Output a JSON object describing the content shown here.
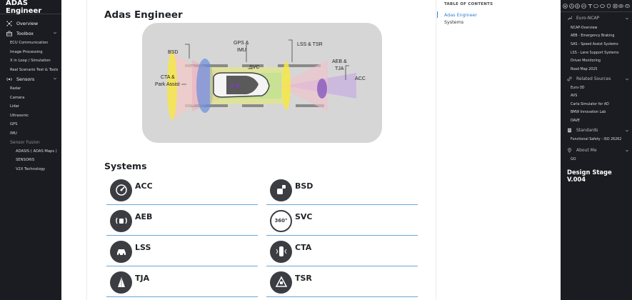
{
  "left_sidebar": {
    "brand": "ADAS Engineer",
    "items": [
      {
        "label": "Overview"
      },
      {
        "label": "Toolbox"
      },
      {
        "label": "ECU Communication"
      },
      {
        "label": "Image Processing"
      },
      {
        "label": "X in Loop / Simulation"
      },
      {
        "label": "Real Scenario Test & Tools"
      },
      {
        "label": "Sensors"
      },
      {
        "label": "Radar"
      },
      {
        "label": "Camera"
      },
      {
        "label": "Lidar"
      },
      {
        "label": "Ultrasonic"
      },
      {
        "label": "GPS"
      },
      {
        "label": "IMU"
      },
      {
        "label": "Sensor Fusion"
      },
      {
        "label": "ADASIS ( ADAS Maps )"
      },
      {
        "label": "SENSORIS"
      },
      {
        "label": "V2X Technology"
      }
    ]
  },
  "main": {
    "title": "Adas Engineer",
    "diagram": {
      "labels": {
        "bsd": "BSD",
        "gps": "GPS &",
        "imu": "IMU",
        "lss_tsr": "LSS & TSR",
        "svc": "SVC",
        "aeb": "AEB &",
        "tja": "TJA",
        "acc": "ACC",
        "cta": "CTA &",
        "park": "Park Assist"
      }
    },
    "systems_title": "Systems",
    "systems": [
      {
        "label": "ACC"
      },
      {
        "label": "BSD"
      },
      {
        "label": "AEB"
      },
      {
        "label": "SVC"
      },
      {
        "label": "LSS"
      },
      {
        "label": "CTA"
      },
      {
        "label": "TJA"
      },
      {
        "label": "TSR"
      }
    ],
    "svc_icon_text": "360°"
  },
  "toc": {
    "heading": "TABLE OF CONTENTS",
    "items": [
      {
        "label": "Adas Engineer",
        "active": true
      },
      {
        "label": "Systems",
        "active": false
      }
    ]
  },
  "right_sidebar": {
    "groups": [
      {
        "label": "Euro-NCAP"
      },
      {
        "label": "Related Sources"
      },
      {
        "label": "Standards"
      },
      {
        "label": "About Me"
      }
    ],
    "euro_ncap_items": [
      "NCAP-Overview",
      "AEB - Emergency Braking",
      "SAS - Speed Assist Systems",
      "LSS - Lane Support Systems",
      "Driver Monitoring",
      "Road Map 2025"
    ],
    "related_items": [
      "Euro-3D",
      "AVS",
      "Carla Simulator for AD",
      "BMW Innovation Lab",
      "DAVE"
    ],
    "standards_items": [
      "Functional Safety - ISO 26262"
    ],
    "about_items": [
      "GO"
    ],
    "stage": "Design Stage V.004"
  },
  "colors": {
    "sidebar_bg": "#1b1c21",
    "accent": "#2f7fd2",
    "card_rule": "#6aa6d6",
    "icon_circle": "#3c3d42",
    "diagram_bg": "#d6d6d6"
  }
}
